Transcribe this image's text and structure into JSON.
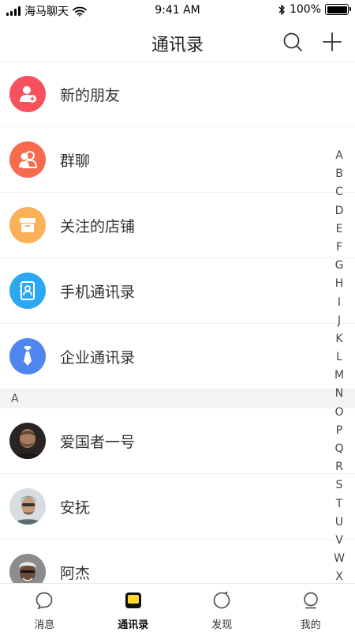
{
  "status_bar": {
    "carrier": "海马聊天",
    "time": "9:41 AM",
    "battery": "100%",
    "battery_level": 1.0
  },
  "nav": {
    "title": "通讯录",
    "search_icon": "search-icon",
    "add_icon": "plus-icon"
  },
  "features": [
    {
      "label": "新的朋友",
      "icon": "add-friend-icon",
      "color": "#F5525E"
    },
    {
      "label": "群聊",
      "icon": "group-chat-icon",
      "color": "#F66A4E"
    },
    {
      "label": "关注的店铺",
      "icon": "shop-icon",
      "color": "#FBB158"
    },
    {
      "label": "手机通讯录",
      "icon": "phone-contacts-icon",
      "color": "#2AA8F2"
    },
    {
      "label": "企业通讯录",
      "icon": "enterprise-contacts-icon",
      "color": "#4F86F0"
    }
  ],
  "sections": [
    {
      "letter": "A",
      "contacts": [
        {
          "name": "爱国者一号"
        },
        {
          "name": "安抚"
        },
        {
          "name": "阿杰"
        }
      ]
    }
  ],
  "alphabet": [
    "A",
    "B",
    "C",
    "D",
    "E",
    "F",
    "G",
    "H",
    "I",
    "J",
    "K",
    "L",
    "M",
    "N",
    "O",
    "P",
    "Q",
    "R",
    "S",
    "T",
    "U",
    "V",
    "W",
    "X"
  ],
  "tabs": [
    {
      "label": "消息",
      "icon": "message-icon",
      "active": false
    },
    {
      "label": "通讯录",
      "icon": "contacts-icon",
      "active": true
    },
    {
      "label": "发现",
      "icon": "discover-icon",
      "active": false
    },
    {
      "label": "我的",
      "icon": "profile-icon",
      "active": false
    }
  ],
  "colors": {
    "accent": "#FFD72E",
    "divider": "#F0F0F0",
    "section_bg": "#F3F3F3"
  }
}
